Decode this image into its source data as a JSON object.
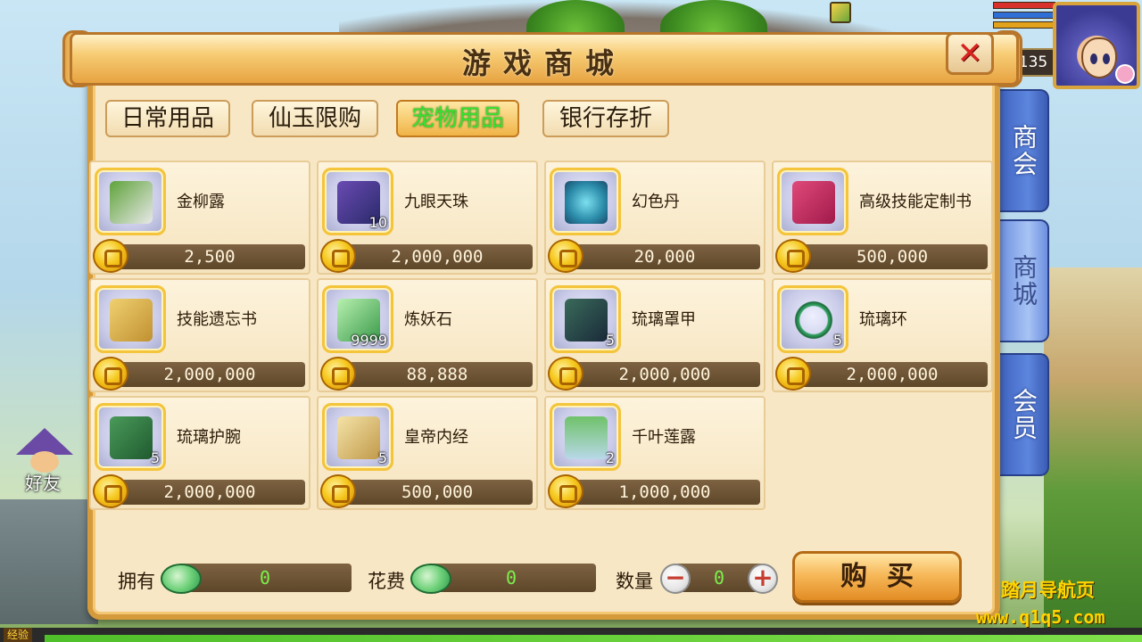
{
  "shop": {
    "title": "游戏商城",
    "tabs": [
      {
        "label": "日常用品",
        "active": false
      },
      {
        "label": "仙玉限购",
        "active": false
      },
      {
        "label": "宠物用品",
        "active": true
      },
      {
        "label": "银行存折",
        "active": false
      }
    ],
    "items": [
      {
        "name": "金柳露",
        "price": "2,500",
        "qty": "",
        "icon": "willow-dew-icon"
      },
      {
        "name": "九眼天珠",
        "price": "2,000,000",
        "qty": "10",
        "icon": "nine-eye-bead-icon"
      },
      {
        "name": "幻色丹",
        "price": "20,000",
        "qty": "",
        "icon": "illusion-pill-icon"
      },
      {
        "name": "高级技能定制书",
        "price": "500,000",
        "qty": "",
        "icon": "skill-book-icon"
      },
      {
        "name": "技能遗忘书",
        "price": "2,000,000",
        "qty": "",
        "icon": "forget-scroll-icon"
      },
      {
        "name": "炼妖石",
        "price": "88,888",
        "qty": "9999",
        "icon": "demon-stone-icon"
      },
      {
        "name": "琉璃罩甲",
        "price": "2,000,000",
        "qty": "5",
        "icon": "glaze-armor-icon"
      },
      {
        "name": "琉璃环",
        "price": "2,000,000",
        "qty": "5",
        "icon": "glaze-ring-icon"
      },
      {
        "name": "琉璃护腕",
        "price": "2,000,000",
        "qty": "5",
        "icon": "glaze-bracer-icon"
      },
      {
        "name": "皇帝内经",
        "price": "500,000",
        "qty": "5",
        "icon": "emperor-scripture-icon"
      },
      {
        "name": "千叶莲露",
        "price": "1,000,000",
        "qty": "2",
        "icon": "lotus-dew-icon"
      }
    ],
    "footer": {
      "owned_label": "拥有",
      "owned_value": "0",
      "cost_label": "花费",
      "cost_value": "0",
      "quantity_label": "数量",
      "quantity_value": "0",
      "minus": "−",
      "plus": "+",
      "buy_label": "购买"
    }
  },
  "player": {
    "level": "135"
  },
  "side_tabs": [
    {
      "label": "商会",
      "active": false
    },
    {
      "label": "商城",
      "active": true
    },
    {
      "label": "会员",
      "active": false
    }
  ],
  "friend_label": "好友",
  "watermark": {
    "title": "踏月导航页",
    "url": "www.q1q5.com"
  },
  "exp_label": "经验",
  "colors": {
    "frame": "#d59a3c",
    "active_tab_text": "#39e02f",
    "price_bar": "#5d4629",
    "side_tab": "#3f63c0"
  }
}
